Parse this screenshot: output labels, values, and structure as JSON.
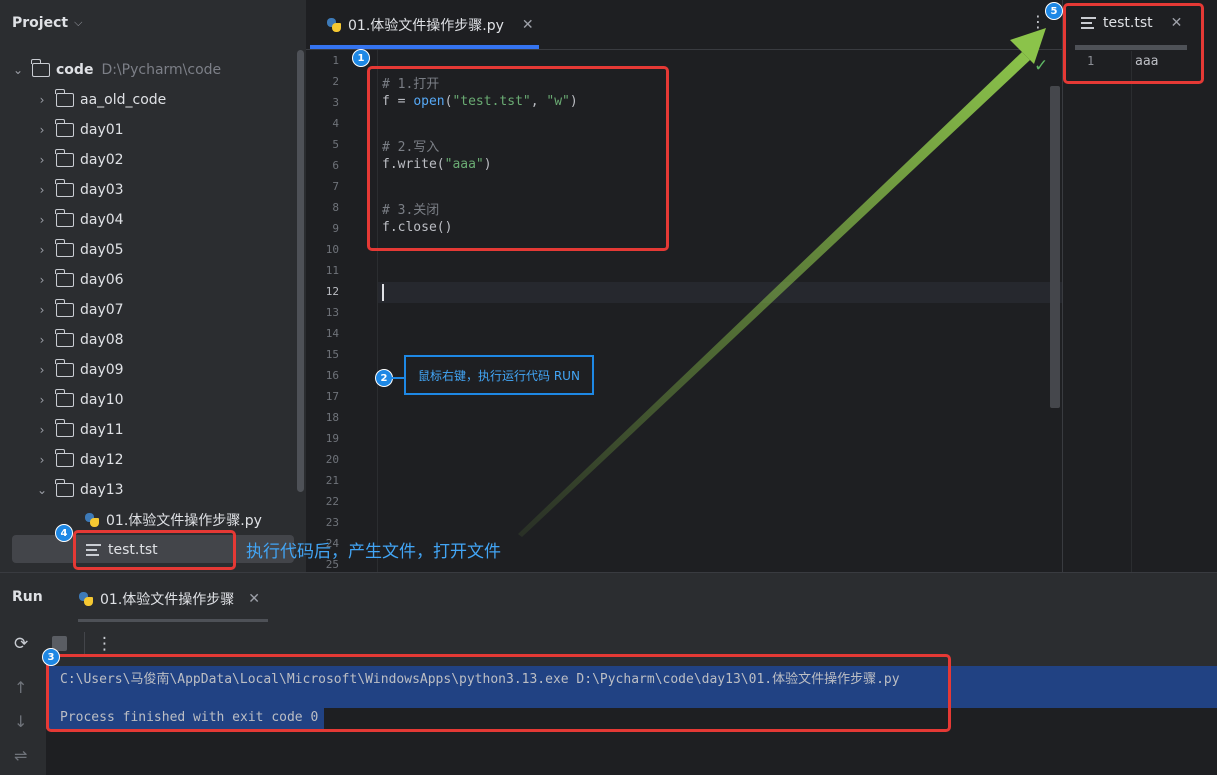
{
  "sidebar": {
    "title": "Project",
    "root": {
      "name": "code",
      "path": "D:\\Pycharm\\code"
    },
    "folders": [
      "aa_old_code",
      "day01",
      "day02",
      "day03",
      "day04",
      "day05",
      "day06",
      "day07",
      "day08",
      "day09",
      "day10",
      "day11",
      "day12",
      "day13"
    ],
    "files": [
      "01.体验文件操作步骤.py",
      "test.tst"
    ]
  },
  "editor": {
    "tab_label": "01.体验文件操作步骤.py",
    "line_numbers": [
      "1",
      "2",
      "3",
      "4",
      "5",
      "6",
      "7",
      "8",
      "9",
      "10",
      "11",
      "12",
      "13",
      "14",
      "15",
      "16",
      "17",
      "18",
      "19",
      "20",
      "21",
      "22",
      "23",
      "24",
      "25"
    ],
    "code": {
      "c1": "# 1.打开",
      "l3_a": "f = ",
      "l3_fn": "open",
      "l3_b": "(",
      "l3_s1": "\"test.tst\"",
      "l3_c": ", ",
      "l3_s2": "\"w\"",
      "l3_d": ")",
      "c2": "# 2.写入",
      "l6_a": "f.write(",
      "l6_s": "\"aaa\"",
      "l6_b": ")",
      "c3": "# 3.关闭",
      "l9": "f.close()"
    }
  },
  "preview": {
    "tab_label": "test.tst",
    "line_number": "1",
    "content": "aaa"
  },
  "run": {
    "title": "Run",
    "tab_label": "01.体验文件操作步骤",
    "output_line1": "C:\\Users\\马俊南\\AppData\\Local\\Microsoft\\WindowsApps\\python3.13.exe D:\\Pycharm\\code\\day13\\01.体验文件操作步骤.py",
    "output_line2": "Process finished with exit code 0"
  },
  "annotations": {
    "badges": [
      "1",
      "2",
      "3",
      "4",
      "5"
    ],
    "note": "鼠标右键，执行运行代码 RUN",
    "caption": "执行代码后，产生文件，打开文件"
  },
  "colors": {
    "accent": "#3574f0",
    "annotation_red": "#e53935",
    "annotation_blue": "#1e88e5",
    "arrow_green": "#8bc34a",
    "selection": "#214283"
  }
}
